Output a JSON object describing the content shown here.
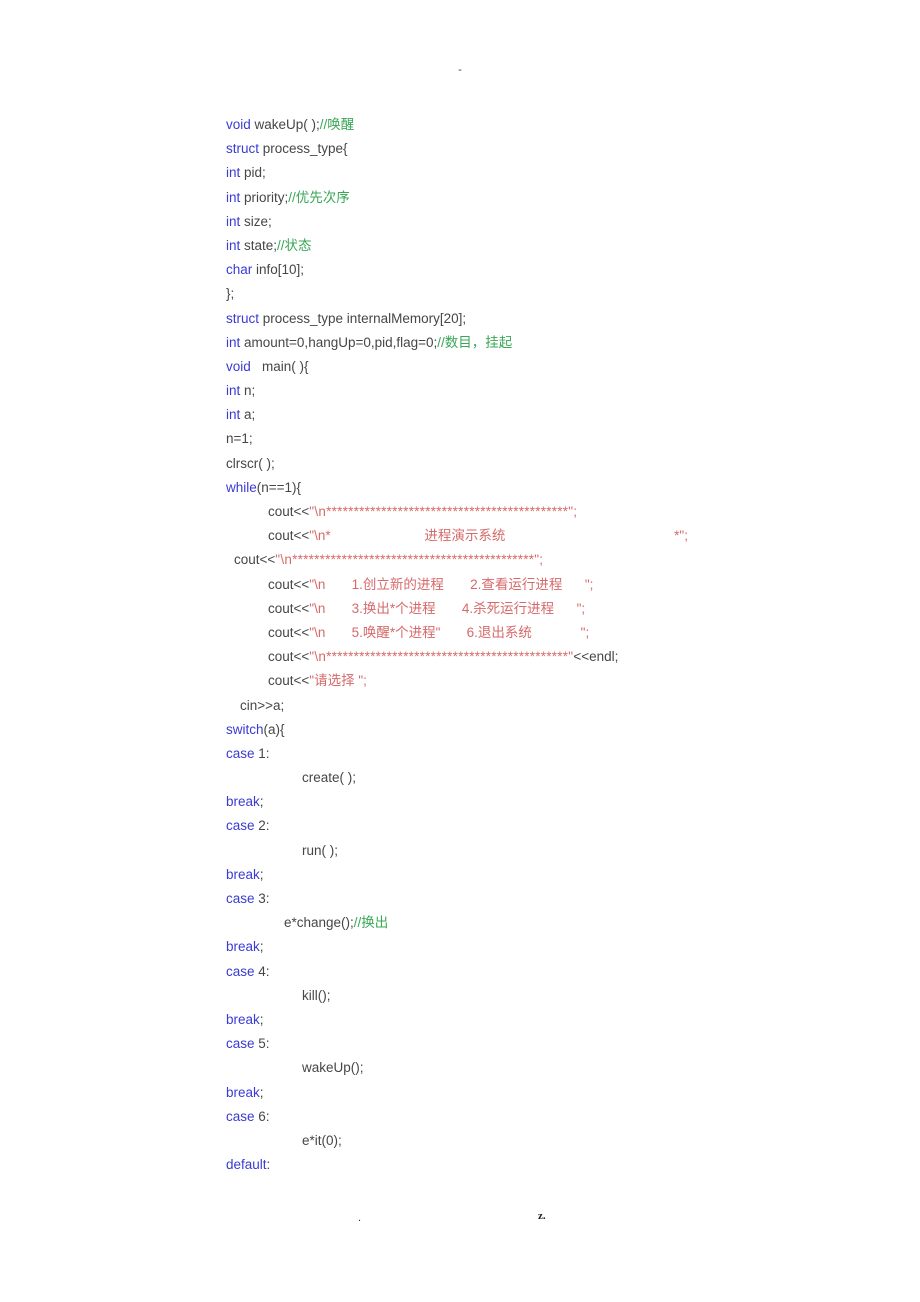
{
  "document": {
    "header_mark": "-",
    "footer_left_mark": ".",
    "footer_right_mark": "z.",
    "colors": {
      "keyword": "#3a3ad4",
      "comment": "#3aa757",
      "string": "#d66a6a",
      "plain": "#464646",
      "background": "#ffffff"
    },
    "language": "C++",
    "title": "process demonstration system source listing"
  },
  "code": {
    "lines": [
      {
        "indent": 0,
        "parts": [
          {
            "t": "kw",
            "v": "void"
          },
          {
            "t": "pl",
            "v": " wakeUp( );"
          },
          {
            "t": "cm",
            "v": "//唤醒"
          }
        ]
      },
      {
        "indent": 0,
        "parts": [
          {
            "t": "kw",
            "v": "struct"
          },
          {
            "t": "pl",
            "v": " process_type{"
          }
        ]
      },
      {
        "indent": 0,
        "parts": [
          {
            "t": "kw",
            "v": "int"
          },
          {
            "t": "pl",
            "v": " pid;"
          }
        ]
      },
      {
        "indent": 0,
        "parts": [
          {
            "t": "kw",
            "v": "int"
          },
          {
            "t": "pl",
            "v": " priority;"
          },
          {
            "t": "cm",
            "v": "//优先次序"
          }
        ]
      },
      {
        "indent": 0,
        "parts": [
          {
            "t": "kw",
            "v": "int"
          },
          {
            "t": "pl",
            "v": " size;"
          }
        ]
      },
      {
        "indent": 0,
        "parts": [
          {
            "t": "kw",
            "v": "int"
          },
          {
            "t": "pl",
            "v": " state;"
          },
          {
            "t": "cm",
            "v": "//状态"
          }
        ]
      },
      {
        "indent": 0,
        "parts": [
          {
            "t": "kw",
            "v": "char"
          },
          {
            "t": "pl",
            "v": " info[10];"
          }
        ]
      },
      {
        "indent": 0,
        "parts": [
          {
            "t": "pl",
            "v": "};"
          }
        ]
      },
      {
        "indent": 0,
        "parts": [
          {
            "t": "kw",
            "v": "struct"
          },
          {
            "t": "pl",
            "v": " process_type internalMemory[20];"
          }
        ]
      },
      {
        "indent": 0,
        "parts": [
          {
            "t": "kw",
            "v": "int"
          },
          {
            "t": "pl",
            "v": " amount=0,hangUp=0,pid,flag=0;"
          },
          {
            "t": "cm",
            "v": "//数目，挂起"
          }
        ]
      },
      {
        "indent": 0,
        "parts": [
          {
            "t": "kw",
            "v": "void"
          },
          {
            "t": "pl",
            "v": "   main( ){"
          }
        ]
      },
      {
        "indent": 0,
        "parts": [
          {
            "t": "kw",
            "v": "int"
          },
          {
            "t": "pl",
            "v": " n;"
          }
        ]
      },
      {
        "indent": 0,
        "parts": [
          {
            "t": "kw",
            "v": "int"
          },
          {
            "t": "pl",
            "v": " a;"
          }
        ]
      },
      {
        "indent": 0,
        "parts": [
          {
            "t": "pl",
            "v": "n=1;"
          }
        ]
      },
      {
        "indent": 0,
        "parts": [
          {
            "t": "pl",
            "v": "clrscr( );"
          }
        ]
      },
      {
        "indent": 0,
        "parts": [
          {
            "t": "kw",
            "v": "while"
          },
          {
            "t": "pl",
            "v": "(n==1){"
          }
        ]
      },
      {
        "indent": 42,
        "parts": [
          {
            "t": "pl",
            "v": "cout<<"
          },
          {
            "t": "str",
            "v": "\"\\n********************************************\";"
          }
        ]
      },
      {
        "indent": 42,
        "parts": [
          {
            "t": "pl",
            "v": "cout<<"
          },
          {
            "t": "str",
            "v": "\"\\n*                         进程演示系统                                             *\";"
          }
        ]
      },
      {
        "indent": 8,
        "parts": [
          {
            "t": "pl",
            "v": "cout<<"
          },
          {
            "t": "str",
            "v": "\"\\n********************************************\";"
          }
        ]
      },
      {
        "indent": 42,
        "parts": [
          {
            "t": "pl",
            "v": "cout<<"
          },
          {
            "t": "str",
            "v": "\"\\n       1.创立新的进程       2.查看运行进程      \";"
          }
        ]
      },
      {
        "indent": 42,
        "parts": [
          {
            "t": "pl",
            "v": "cout<<"
          },
          {
            "t": "str",
            "v": "\"\\n       3.换出*个进程       4.杀死运行进程      \";"
          }
        ]
      },
      {
        "indent": 42,
        "parts": [
          {
            "t": "pl",
            "v": "cout<<"
          },
          {
            "t": "str",
            "v": "\"\\n       5.唤醒*个进程\"       6.退出系统             \";"
          }
        ]
      },
      {
        "indent": 42,
        "parts": [
          {
            "t": "pl",
            "v": "cout<<"
          },
          {
            "t": "str",
            "v": "\"\\n********************************************\""
          },
          {
            "t": "pl",
            "v": "<<endl;"
          }
        ]
      },
      {
        "indent": 42,
        "parts": [
          {
            "t": "pl",
            "v": "cout<<"
          },
          {
            "t": "str",
            "v": "\"请选择 \";"
          }
        ]
      },
      {
        "indent": 14,
        "parts": [
          {
            "t": "pl",
            "v": "cin>>a;"
          }
        ]
      },
      {
        "indent": 0,
        "parts": [
          {
            "t": "kw",
            "v": "switch"
          },
          {
            "t": "pl",
            "v": "(a){"
          }
        ]
      },
      {
        "indent": 0,
        "parts": [
          {
            "t": "kw",
            "v": "case"
          },
          {
            "t": "pl",
            "v": " 1:"
          }
        ]
      },
      {
        "indent": 76,
        "parts": [
          {
            "t": "pl",
            "v": "create( );"
          }
        ]
      },
      {
        "indent": 0,
        "parts": [
          {
            "t": "kw",
            "v": "break"
          },
          {
            "t": "pl",
            "v": ";"
          }
        ]
      },
      {
        "indent": 0,
        "parts": [
          {
            "t": "kw",
            "v": "case"
          },
          {
            "t": "pl",
            "v": " 2:"
          }
        ]
      },
      {
        "indent": 76,
        "parts": [
          {
            "t": "pl",
            "v": "run( );"
          }
        ]
      },
      {
        "indent": 0,
        "parts": [
          {
            "t": "kw",
            "v": "break"
          },
          {
            "t": "pl",
            "v": ";"
          }
        ]
      },
      {
        "indent": 0,
        "parts": [
          {
            "t": "kw",
            "v": "case"
          },
          {
            "t": "pl",
            "v": " 3:"
          }
        ]
      },
      {
        "indent": 58,
        "parts": [
          {
            "t": "pl",
            "v": "e*change();"
          },
          {
            "t": "cm",
            "v": "//换出"
          }
        ]
      },
      {
        "indent": 0,
        "parts": [
          {
            "t": "kw",
            "v": "break"
          },
          {
            "t": "pl",
            "v": ";"
          }
        ]
      },
      {
        "indent": 0,
        "parts": [
          {
            "t": "kw",
            "v": "case"
          },
          {
            "t": "pl",
            "v": " 4:"
          }
        ]
      },
      {
        "indent": 76,
        "parts": [
          {
            "t": "pl",
            "v": "kill();"
          }
        ]
      },
      {
        "indent": 0,
        "parts": [
          {
            "t": "kw",
            "v": "break"
          },
          {
            "t": "pl",
            "v": ";"
          }
        ]
      },
      {
        "indent": 0,
        "parts": [
          {
            "t": "kw",
            "v": "case"
          },
          {
            "t": "pl",
            "v": " 5:"
          }
        ]
      },
      {
        "indent": 76,
        "parts": [
          {
            "t": "pl",
            "v": "wakeUp();"
          }
        ]
      },
      {
        "indent": 0,
        "parts": [
          {
            "t": "kw",
            "v": "break"
          },
          {
            "t": "pl",
            "v": ";"
          }
        ]
      },
      {
        "indent": 0,
        "parts": [
          {
            "t": "kw",
            "v": "case"
          },
          {
            "t": "pl",
            "v": " 6:"
          }
        ]
      },
      {
        "indent": 76,
        "parts": [
          {
            "t": "pl",
            "v": "e*it(0);"
          }
        ]
      },
      {
        "indent": 0,
        "parts": [
          {
            "t": "kw",
            "v": "default"
          },
          {
            "t": "pl",
            "v": ":"
          }
        ]
      }
    ]
  }
}
